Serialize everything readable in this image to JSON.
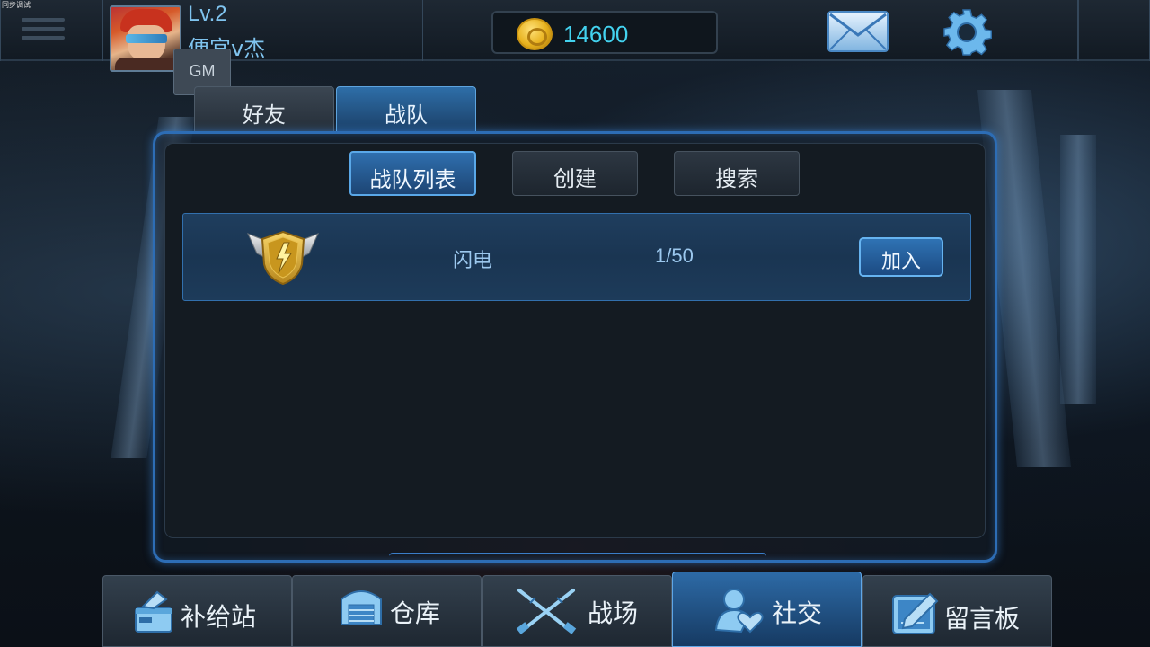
{
  "debug_label": "同步调试",
  "player": {
    "level": "Lv.2",
    "name": "便宜v杰",
    "badge": "GM"
  },
  "currency": {
    "amount": "14600",
    "icon": "gold-coin-icon"
  },
  "header_icons": [
    "menu-icon",
    "mail-icon",
    "gear-icon"
  ],
  "tabs": [
    {
      "label": "好友",
      "active": false
    },
    {
      "label": "战队",
      "active": true
    }
  ],
  "sub_tabs": [
    {
      "label": "战队列表",
      "active": true
    },
    {
      "label": "创建",
      "active": false
    },
    {
      "label": "搜索",
      "active": false
    }
  ],
  "teams": [
    {
      "name": "闪电",
      "members": "1/50",
      "action": "加入",
      "icon": "lightning-emblem-icon"
    }
  ],
  "bottom_nav": [
    {
      "label": "补给站",
      "icon": "supply-station-icon",
      "active": false
    },
    {
      "label": "仓库",
      "icon": "warehouse-icon",
      "active": false
    },
    {
      "label": "战场",
      "icon": "crossed-rifles-icon",
      "active": false
    },
    {
      "label": "社交",
      "icon": "social-icon",
      "active": true
    },
    {
      "label": "留言板",
      "icon": "message-board-icon",
      "active": false
    }
  ],
  "colors": {
    "accent_blue": "#2d6db5",
    "currency_text": "#43d2ef",
    "player_text": "#7fc3ee"
  }
}
